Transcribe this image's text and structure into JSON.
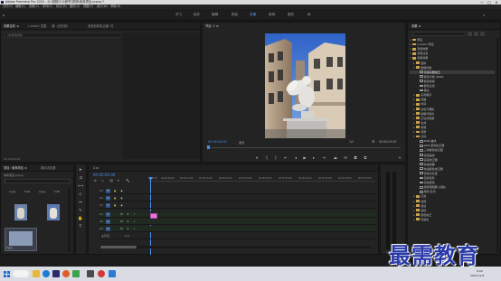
{
  "window": {
    "title": "Adobe Premiere Pro 2020 - D:\\视频\\5\\3\\研究\\剪辑\\电商项目.prproj *",
    "controls": [
      "—",
      "□",
      "✕"
    ]
  },
  "menu": [
    "文件(F)",
    "编辑(E)",
    "剪辑(C)",
    "序列(S)",
    "标记(M)",
    "图形(G)",
    "视图(V)",
    "窗口(W)",
    "帮助(H)"
  ],
  "workspaces": {
    "tabs": [
      "学习",
      "组件",
      "编辑",
      "颜色",
      "效果",
      "音频",
      "图形",
      "库"
    ],
    "active_index": 4
  },
  "source_panel": {
    "tabs": [
      "效果控件 ≡",
      "Lumetri 范围",
      "源: (无剪辑)",
      "音频剪辑混合器: 时"
    ],
    "no_clip_text": "(未选择剪辑)",
    "timecode": "00:00:00:00"
  },
  "program_monitor": {
    "tab": "节目: 1 ≡",
    "timecode_left": "00:00:00:00",
    "fit": "适合",
    "ratio": "1/2",
    "timecode_right": "00:00:03:00"
  },
  "effects_panel": {
    "tab": "效果 ≡",
    "tree": [
      {
        "label": "预设",
        "kind": "folder",
        "depth": 0,
        "open": false
      },
      {
        "label": "Lumetri 预设",
        "kind": "folder",
        "depth": 0,
        "open": false
      },
      {
        "label": "音频效果",
        "kind": "folder",
        "depth": 0,
        "open": false
      },
      {
        "label": "音频过渡",
        "kind": "folder",
        "depth": 0,
        "open": false
      },
      {
        "label": "视频效果",
        "kind": "folder",
        "depth": 0,
        "open": true
      },
      {
        "label": "变换",
        "kind": "folder",
        "depth": 1,
        "open": false
      },
      {
        "label": "图像控制",
        "kind": "folder",
        "depth": 1,
        "open": true
      },
      {
        "label": "灰度系数校正",
        "kind": "effect",
        "depth": 2,
        "selected": true
      },
      {
        "label": "颜色平衡 (RGB)",
        "kind": "effect",
        "depth": 2
      },
      {
        "label": "颜色替换",
        "kind": "effect",
        "depth": 2
      },
      {
        "label": "颜色过滤",
        "kind": "effect",
        "depth": 2
      },
      {
        "label": "黑白",
        "kind": "effect",
        "depth": 2
      },
      {
        "label": "实用程序",
        "kind": "folder",
        "depth": 1
      },
      {
        "label": "扭曲",
        "kind": "folder",
        "depth": 1
      },
      {
        "label": "时间",
        "kind": "folder",
        "depth": 1
      },
      {
        "label": "杂色与颗粒",
        "kind": "folder",
        "depth": 1
      },
      {
        "label": "模糊与锐化",
        "kind": "folder",
        "depth": 1
      },
      {
        "label": "沉浸式视频",
        "kind": "folder",
        "depth": 1
      },
      {
        "label": "生成",
        "kind": "folder",
        "depth": 1
      },
      {
        "label": "视频",
        "kind": "folder",
        "depth": 1
      },
      {
        "label": "调整",
        "kind": "folder",
        "depth": 1
      },
      {
        "label": "过时",
        "kind": "folder",
        "depth": 1,
        "open": true
      },
      {
        "label": "RGB 曲线",
        "kind": "effect",
        "depth": 2
      },
      {
        "label": "RGB 颜色校正器",
        "kind": "effect",
        "depth": 2
      },
      {
        "label": "三向颜色校正器",
        "kind": "effect",
        "depth": 2
      },
      {
        "label": "亮度曲线",
        "kind": "effect",
        "depth": 2
      },
      {
        "label": "亮度校正器",
        "kind": "effect",
        "depth": 2
      },
      {
        "label": "快速模糊",
        "kind": "effect",
        "depth": 2
      },
      {
        "label": "快速颜色校正器",
        "kind": "effect",
        "depth": 2
      },
      {
        "label": "自动对比度",
        "kind": "effect",
        "depth": 2
      },
      {
        "label": "自动色阶",
        "kind": "effect",
        "depth": 2
      },
      {
        "label": "自动颜色",
        "kind": "effect",
        "depth": 2
      },
      {
        "label": "视频限幅器 (旧版)",
        "kind": "effect",
        "depth": 2
      },
      {
        "label": "阴影/高光",
        "kind": "effect",
        "depth": 2
      },
      {
        "label": "过渡",
        "kind": "folder",
        "depth": 1
      },
      {
        "label": "透视",
        "kind": "folder",
        "depth": 1
      },
      {
        "label": "通道",
        "kind": "folder",
        "depth": 1
      },
      {
        "label": "键控",
        "kind": "folder",
        "depth": 1
      },
      {
        "label": "颜色校正",
        "kind": "folder",
        "depth": 1
      },
      {
        "label": "风格化",
        "kind": "folder",
        "depth": 1
      }
    ]
  },
  "project_panel": {
    "tabs": [
      "项目: 电商项目 ≡",
      "媒体浏览器"
    ],
    "project_file": "电商项目.prproj",
    "items": [
      {
        "name": "1.jpg",
        "duration": "5:00"
      },
      {
        "name": "2.jpg",
        "duration": "5:00"
      },
      {
        "name": "3.jpg",
        "duration": "5:00"
      }
    ]
  },
  "timeline": {
    "tab": "1 ≡",
    "timecode": "00:00:00:00",
    "ruler": [
      "00:00",
      "00:00:05:00",
      "00:00:10:00",
      "00:00:15:00",
      "00:00:20:00",
      "00:00:25:00",
      "00:00:30:00",
      "00:00:35:00",
      "00:00:40:00",
      "00:00:45:00",
      "00:00:50:00",
      "00:00:55:00"
    ],
    "video_tracks": [
      "V3",
      "V2",
      "V1"
    ],
    "audio_tracks": [
      "A1",
      "A2",
      "A3"
    ],
    "master": "主声道",
    "master_value": "0.0",
    "clip_color": "#e07ad6"
  },
  "taskbar": {
    "time": "9:00",
    "date": "2021/11/5"
  },
  "watermark": "最需教育",
  "colors": {
    "accent": "#5a9cf8",
    "timecode": "#4a8eea",
    "clip": "#e07ad6",
    "watermark": "#2a3aa8"
  }
}
